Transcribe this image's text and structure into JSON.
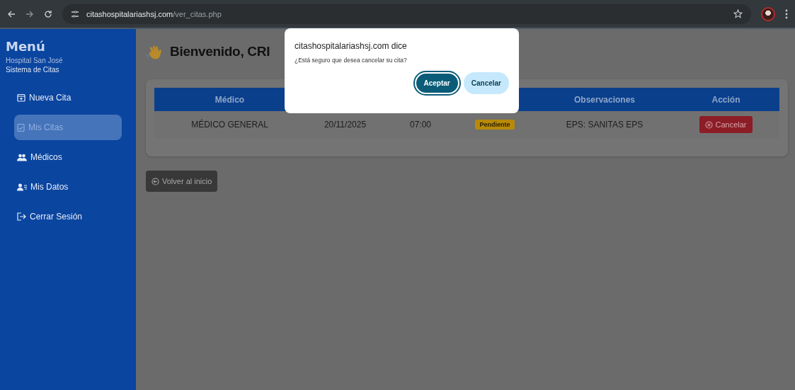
{
  "browser": {
    "url_host": "citashospitalariashsj.com",
    "url_path": "/ver_citas.php"
  },
  "sidebar": {
    "title": "Menú",
    "subtitle": "Hospital San José",
    "subtitle2": "Sistema de Citas",
    "items": [
      {
        "label": "Nueva Cita",
        "selected": false
      },
      {
        "label": "Mis Citas",
        "selected": true
      },
      {
        "label": "Médicos",
        "selected": false
      },
      {
        "label": "Mis Datos",
        "selected": false
      },
      {
        "label": "Cerrar Sesión",
        "selected": false
      }
    ]
  },
  "heading": "Bienvenido, CRI",
  "table": {
    "columns": [
      "Médico",
      null,
      null,
      null,
      "Observaciones",
      "Acción"
    ],
    "rows": [
      {
        "cells": [
          "MÉDICO GENERAL",
          "20/11/2025",
          "07:00"
        ],
        "status": "Pendiente",
        "observations": "EPS: SANITAS EPS",
        "action": "Cancelar"
      }
    ]
  },
  "back_button": "Volver al inicio",
  "dialog": {
    "title": "citashospitalariashsj.com dice",
    "message": "¿Está seguro que desea cancelar su cita?",
    "buttons": [
      {
        "label": "Aceptar",
        "kind": "primary"
      },
      {
        "label": "Cancelar",
        "kind": "secondary"
      }
    ]
  }
}
